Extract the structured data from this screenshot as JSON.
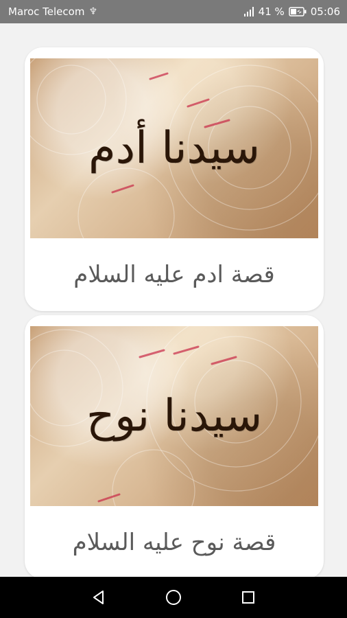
{
  "status_bar": {
    "carrier": "Maroc Telecom",
    "battery_percent": "41 %",
    "time": "05:06",
    "icons": [
      "usb-icon",
      "signal-icon",
      "battery-icon"
    ]
  },
  "stories": [
    {
      "image_text": "سيدنا أدم",
      "title": "قصة ادم عليه السلام"
    },
    {
      "image_text": "سيدنا نوح",
      "title": "قصة نوح عليه السلام"
    }
  ],
  "nav_bar": {
    "icons": [
      "back-icon",
      "home-icon",
      "recents-icon"
    ]
  },
  "colors": {
    "status_bar": "#7a7a7a",
    "background": "#f2f2f2",
    "card": "#ffffff",
    "title_text": "#5a5a5a",
    "nav_bar": "#000000"
  }
}
